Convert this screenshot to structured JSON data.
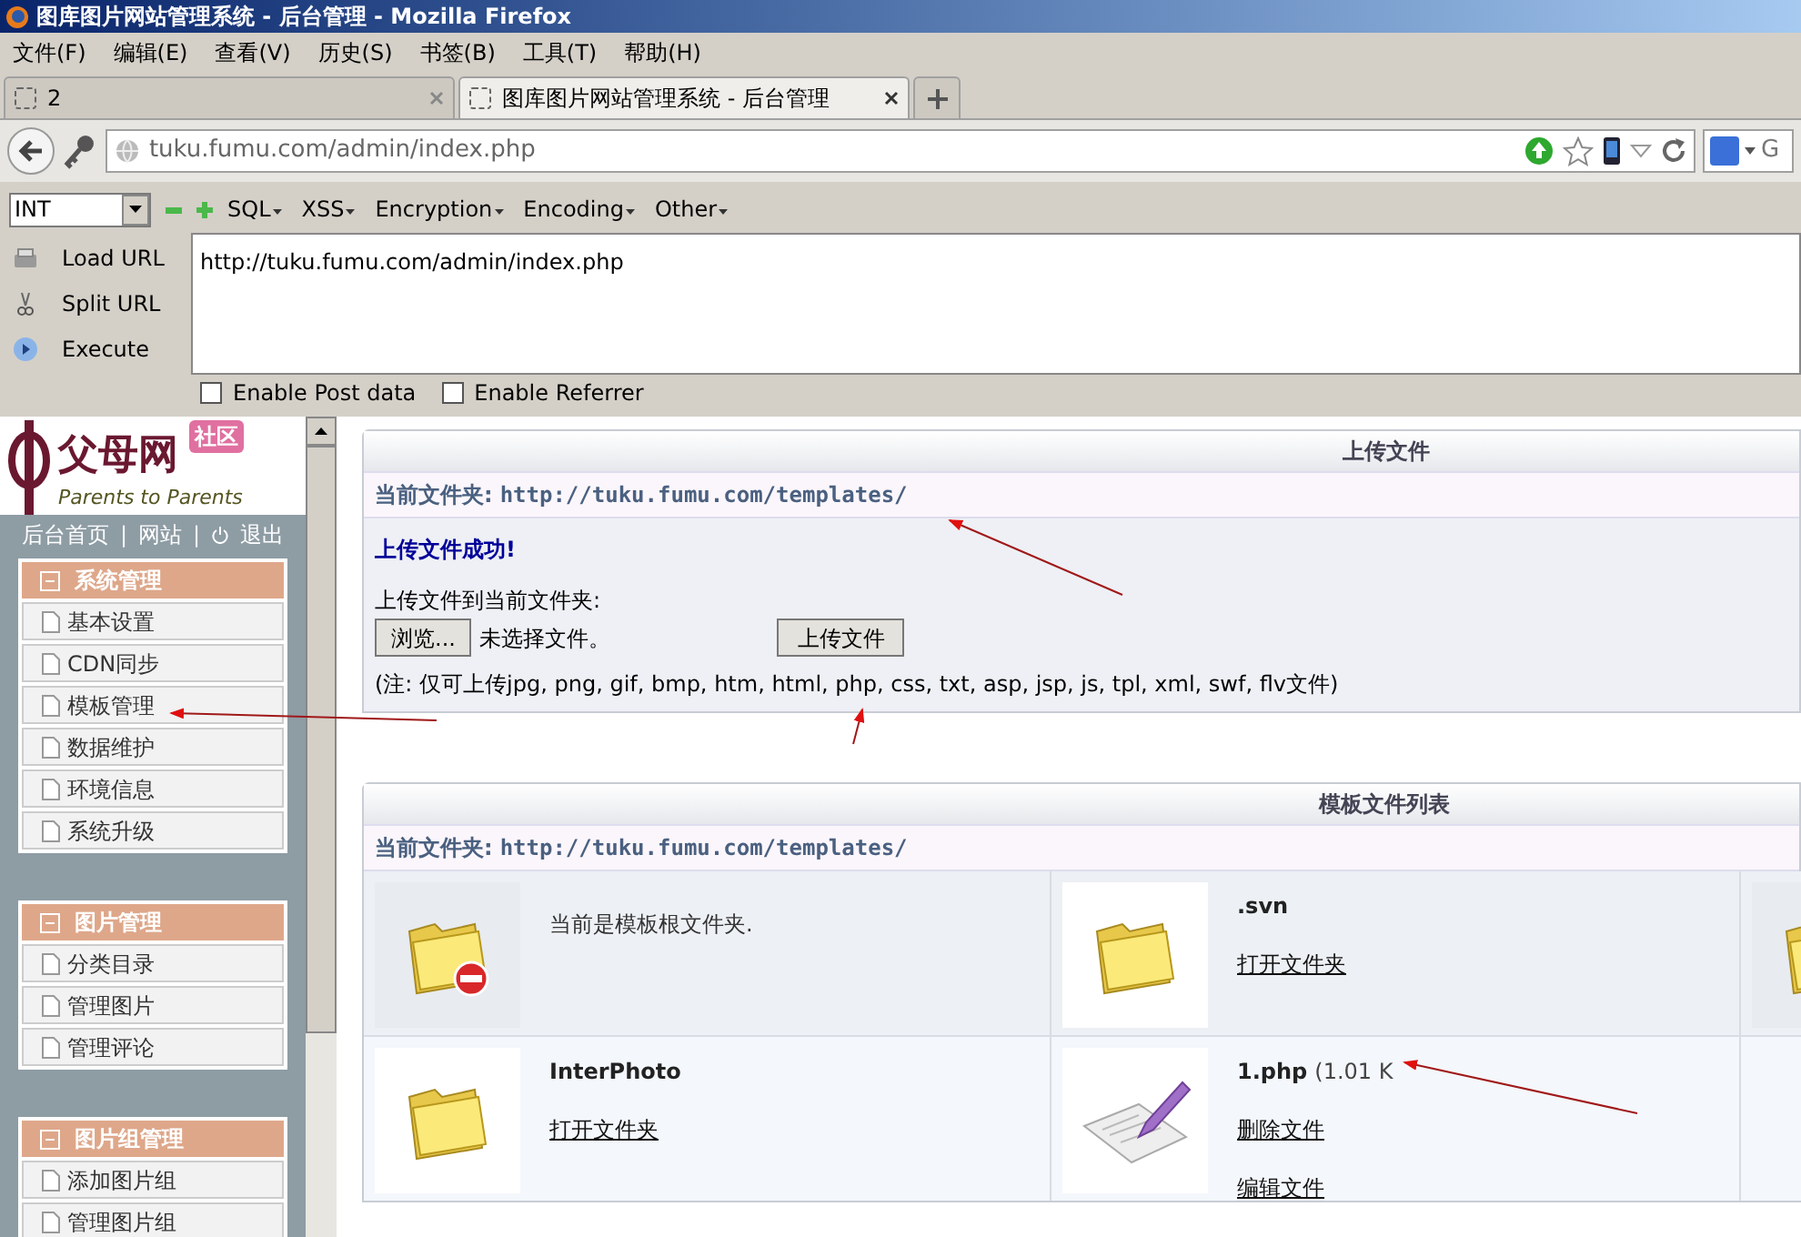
{
  "window": {
    "title": "图库图片网站管理系统 - 后台管理 - Mozilla Firefox"
  },
  "menu_bar": [
    "文件(F)",
    "编辑(E)",
    "查看(V)",
    "历史(S)",
    "书签(B)",
    "工具(T)",
    "帮助(H)"
  ],
  "tabs": [
    {
      "label": "2",
      "selected": false
    },
    {
      "label": "图库图片网站管理系统 - 后台管理",
      "selected": true
    }
  ],
  "address_bar": {
    "url": "tuku.fumu.com/admin/index.php",
    "search_placeholder": "G"
  },
  "hackbar": {
    "select_value": "INT",
    "menus": [
      "SQL",
      "XSS",
      "Encryption",
      "Encoding",
      "Other"
    ],
    "actions": [
      {
        "kind": "load",
        "label": "Load URL"
      },
      {
        "kind": "split",
        "label": "Split URL"
      },
      {
        "kind": "execute",
        "label": "Execute"
      }
    ],
    "url_text": "http://tuku.fumu.com/admin/index.php",
    "options": [
      {
        "label": "Enable Post data",
        "checked": false
      },
      {
        "label": "Enable Referrer",
        "checked": false
      }
    ]
  },
  "sidebar": {
    "logo": {
      "name": "父母网",
      "badge": "社区",
      "tagline": "Parents to Parents"
    },
    "links": [
      "后台首页",
      "网站",
      "退出"
    ],
    "separator": "|",
    "groups": [
      {
        "title": "系统管理",
        "expanded": true,
        "items": [
          "基本设置",
          "CDN同步",
          "模板管理",
          "数据维护",
          "环境信息",
          "系统升级"
        ]
      },
      {
        "title": "图片管理",
        "expanded": true,
        "items": [
          "分类目录",
          "管理图片",
          "管理评论"
        ]
      },
      {
        "title": "图片组管理",
        "expanded": true,
        "items": [
          "添加图片组",
          "管理图片组"
        ]
      }
    ]
  },
  "upload_panel": {
    "title": "上传文件",
    "folder_label": "当前文件夹:",
    "folder_url": "http://tuku.fumu.com/templates/",
    "message": "上传文件成功!",
    "prompt": "上传文件到当前文件夹:",
    "browse_button": "浏览...",
    "file_status": "未选择文件。",
    "upload_button": "上传文件",
    "note": "(注: 仅可上传jpg, png, gif, bmp, htm, html, php, css, txt, asp, jsp, js, tpl, xml, swf, flv文件)"
  },
  "template_list": {
    "title": "模板文件列表",
    "folder_label": "当前文件夹:",
    "folder_url": "http://tuku.fumu.com/templates/",
    "cells": [
      {
        "kind": "root",
        "text": "当前是模板根文件夹."
      },
      {
        "kind": "folder",
        "name": ".svn",
        "links": [
          "打开文件夹"
        ]
      },
      {
        "kind": "folder"
      },
      {
        "kind": "folder",
        "name": "InterPhoto",
        "links": [
          "打开文件夹"
        ]
      },
      {
        "kind": "file",
        "name": "1.php",
        "size": "(1.01 K",
        "links": [
          "删除文件",
          "编辑文件"
        ]
      },
      {
        "kind": "empty"
      }
    ]
  }
}
